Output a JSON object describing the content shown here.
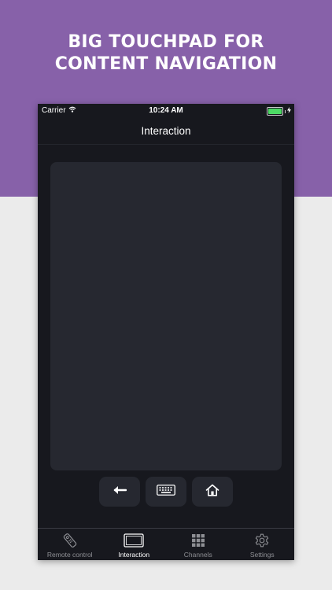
{
  "promo": {
    "headline_line1": "BIG TOUCHPAD FOR",
    "headline_line2": "CONTENT NAVIGATION",
    "background_color": "#8761a9"
  },
  "status_bar": {
    "carrier": "Carrier",
    "time": "10:24 AM",
    "wifi_icon": "wifi-icon",
    "battery_icon": "battery-icon",
    "charging_icon": "bolt-icon"
  },
  "nav": {
    "title": "Interaction"
  },
  "touchpad": {
    "icon": "touchpad-surface"
  },
  "controls": [
    {
      "name": "back-button",
      "icon": "left-arrow-icon"
    },
    {
      "name": "keyboard-button",
      "icon": "keyboard-icon"
    },
    {
      "name": "home-button",
      "icon": "home-icon"
    }
  ],
  "tabs": [
    {
      "label": "Remote control",
      "icon": "remote-icon",
      "active": false
    },
    {
      "label": "Interaction",
      "icon": "screen-icon",
      "active": true
    },
    {
      "label": "Channels",
      "icon": "grid-icon",
      "active": false
    },
    {
      "label": "Settings",
      "icon": "gear-icon",
      "active": false
    }
  ],
  "colors": {
    "accent": "#8761a9",
    "phone_bg": "#17181e",
    "panel_bg": "#262830",
    "battery_green": "#4cd964"
  }
}
